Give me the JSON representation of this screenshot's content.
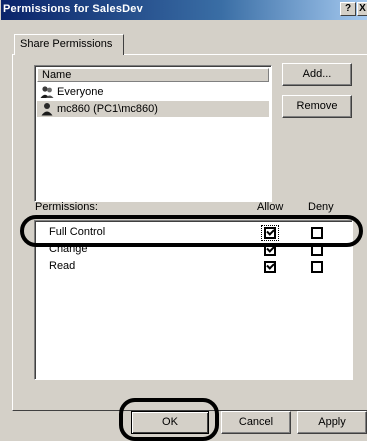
{
  "window": {
    "title": "Permissions for SalesDev",
    "help_label": "?",
    "close_label": "X"
  },
  "tab": {
    "label": "Share Permissions"
  },
  "names": {
    "header": "Name",
    "items": [
      {
        "label": "Everyone",
        "icon": "group-icon",
        "selected": false
      },
      {
        "label": "mc860 (PC1\\mc860)",
        "icon": "user-icon",
        "selected": true
      }
    ]
  },
  "buttons": {
    "add": "Add...",
    "remove": "Remove",
    "ok": "OK",
    "cancel": "Cancel",
    "apply": "Apply"
  },
  "permissions": {
    "label": "Permissions:",
    "allow_header": "Allow",
    "deny_header": "Deny",
    "rows": [
      {
        "name": "Full Control",
        "allow": true,
        "deny": false
      },
      {
        "name": "Change",
        "allow": true,
        "deny": false
      },
      {
        "name": "Read",
        "allow": true,
        "deny": false
      }
    ]
  },
  "colors": {
    "titlebar_start": "#0a246a",
    "titlebar_end": "#a6caf0",
    "face": "#d4d0c8",
    "callout": "#000000"
  }
}
